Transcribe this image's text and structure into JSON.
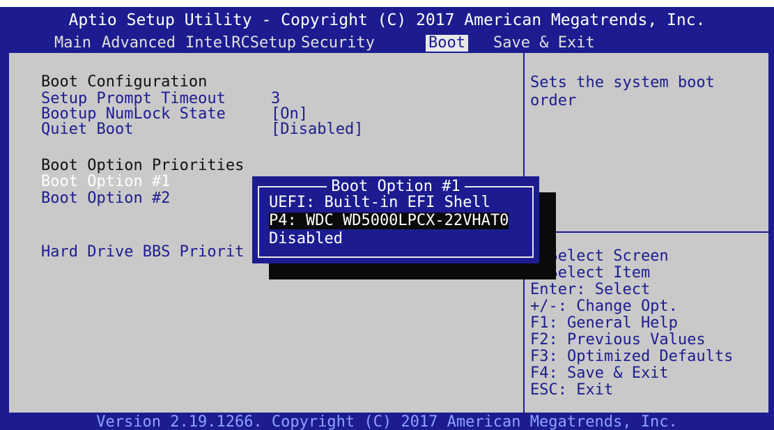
{
  "title": "Aptio Setup Utility - Copyright (C) 2017 American Megatrends, Inc.",
  "tabs": [
    "Main",
    "Advanced",
    "IntelRCSetup",
    "Security",
    "Boot",
    "Save & Exit"
  ],
  "active_tab": "Boot",
  "left": {
    "boot_config_heading": "Boot Configuration",
    "setup_prompt_label": "Setup Prompt Timeout",
    "setup_prompt_value": "3",
    "numlock_label": "Bootup NumLock State",
    "numlock_value": "[On]",
    "quiet_label": "Quiet Boot",
    "quiet_value": "[Disabled]",
    "priorities_heading": "Boot Option Priorities",
    "boot1_label": "Boot Option #1",
    "boot2_label": "Boot Option #2",
    "hdd_bbs_label": "Hard Drive BBS Priorit"
  },
  "help": {
    "text": "Sets the system boot order"
  },
  "keys": [
    "  Select Screen",
    "  Select Item",
    "Enter: Select",
    "+/-: Change Opt.",
    "F1: General Help",
    "F2: Previous Values",
    "F3: Optimized Defaults",
    "F4: Save & Exit",
    "ESC: Exit"
  ],
  "popup": {
    "title": "Boot Option #1",
    "options": [
      "UEFI: Built-in EFI Shell",
      "P4: WDC WD5000LPCX-22VHAT0",
      "Disabled"
    ],
    "selected_index": 1
  },
  "footer": "Version 2.19.1266. Copyright (C) 2017 American Megatrends, Inc."
}
